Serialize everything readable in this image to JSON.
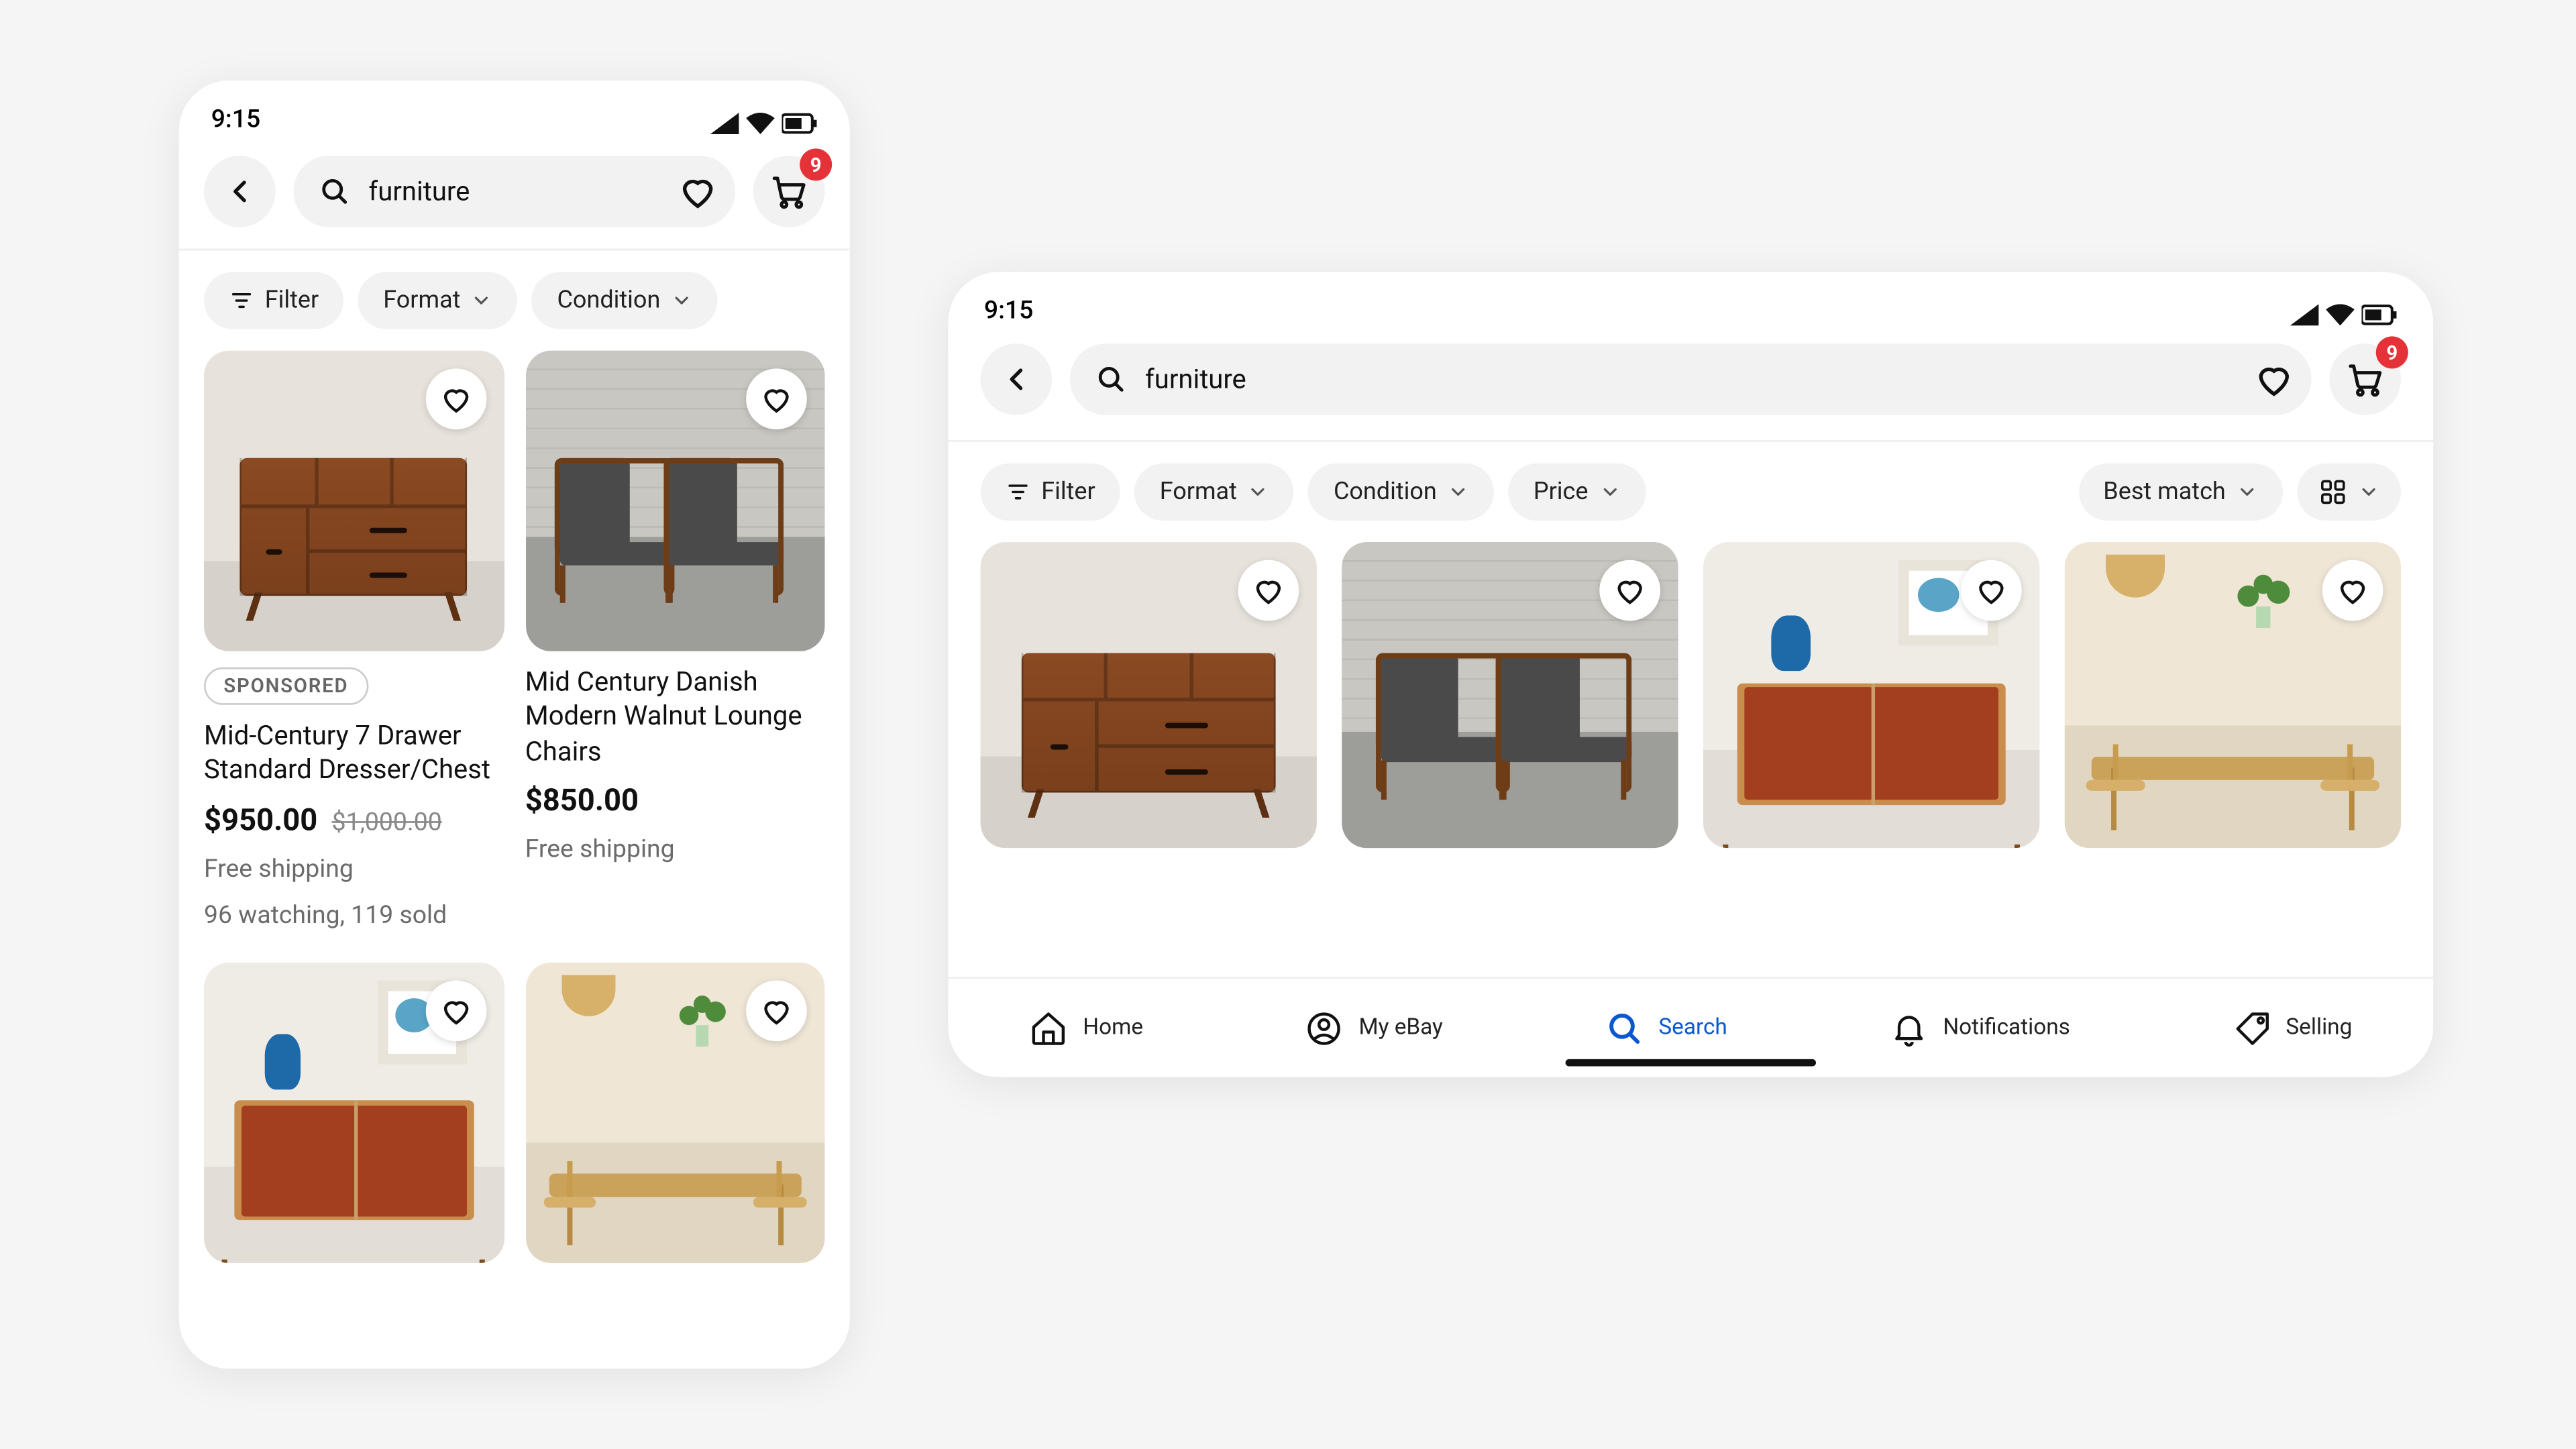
{
  "status": {
    "time": "9:15"
  },
  "search": {
    "query": "furniture"
  },
  "cart": {
    "badge": "9"
  },
  "chips": {
    "filter": "Filter",
    "format": "Format",
    "condition": "Condition",
    "price": "Price",
    "sort": "Best match"
  },
  "phone": {
    "items": [
      {
        "sponsored": "SPONSORED",
        "title": "Mid-Century 7 Drawer Standard Dresser/Chest",
        "price": "$950.00",
        "orig": "$1,000.00",
        "shipping": "Free shipping",
        "stats": "96 watching, 119 sold"
      },
      {
        "title": "Mid Century Danish Modern Walnut Lounge Chairs",
        "price": "$850.00",
        "shipping": "Free shipping"
      }
    ]
  },
  "nav": {
    "home": "Home",
    "myebay": "My eBay",
    "search": "Search",
    "notifications": "Notifications",
    "selling": "Selling"
  }
}
